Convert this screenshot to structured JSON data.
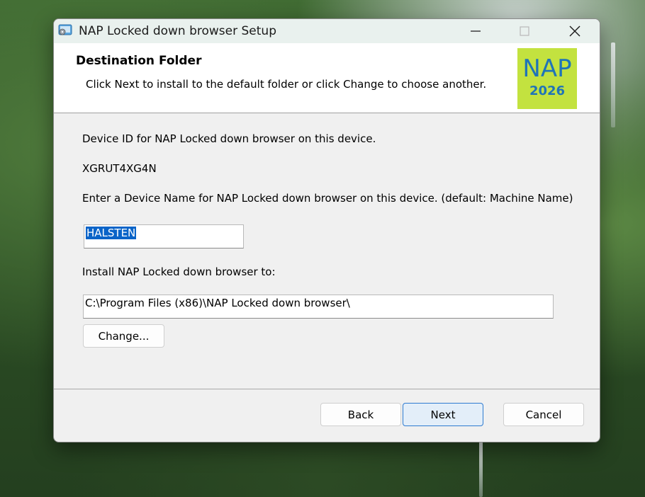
{
  "window": {
    "title": "NAP Locked down browser Setup",
    "controls": {
      "minimize": "—",
      "maximize": "☐",
      "close": "✕"
    }
  },
  "header": {
    "title": "Destination Folder",
    "subtitle": "Click Next to install to the default folder or click Change to choose another.",
    "logo": {
      "name": "NAP",
      "year": "2026",
      "background": "#c3e23f",
      "text_color": "#1f74b8"
    }
  },
  "body": {
    "device_id_label": "Device ID for NAP Locked down browser on this device.",
    "device_id_value": "XGRUT4XG4N",
    "device_name_label": "Enter a Device Name for NAP Locked down browser on this device. (default: Machine Name)",
    "device_name_value": "HALSTEN",
    "install_label": "Install NAP Locked down browser to:",
    "install_path": "C:\\Program Files (x86)\\NAP Locked down browser\\",
    "change_button": "Change..."
  },
  "footer": {
    "back_button": "Back",
    "next_button": "Next",
    "cancel_button": "Cancel"
  },
  "colors": {
    "selection": "#0a64c8",
    "primary_border": "#2e7bd0",
    "titlebar": "#e9f1ee"
  }
}
